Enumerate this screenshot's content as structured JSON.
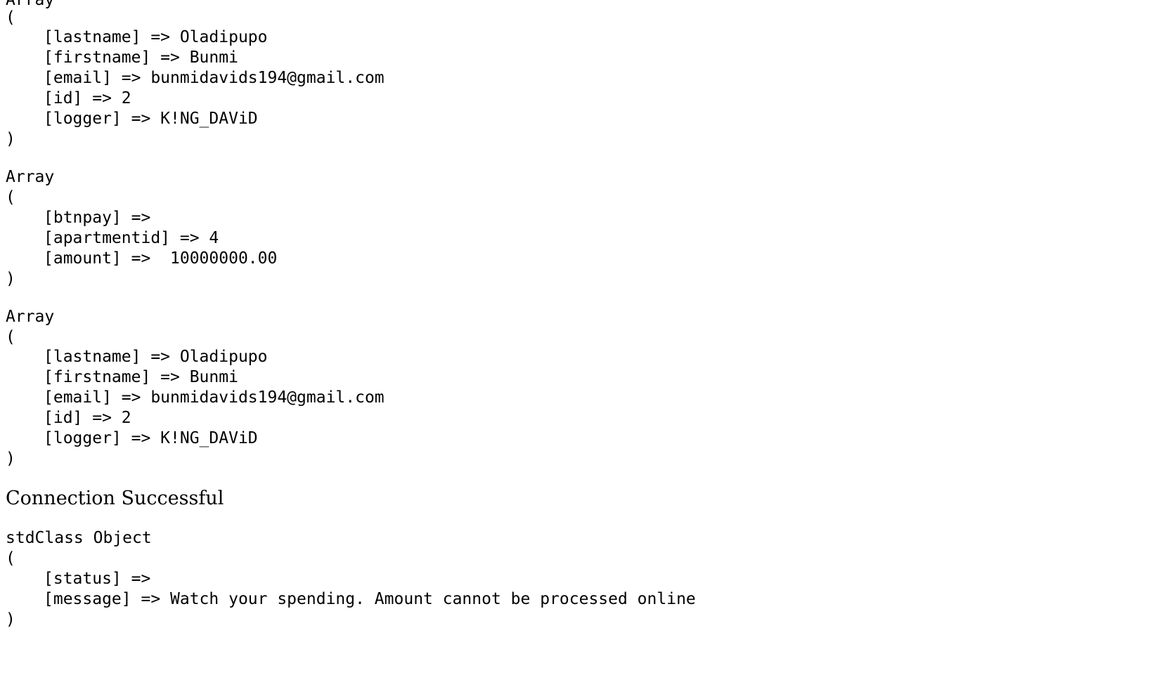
{
  "block1": {
    "header": "Array",
    "open": "(",
    "lines": [
      "[lastname] => Oladipupo",
      "[firstname] => Bunmi",
      "[email] => bunmidavids194@gmail.com",
      "[id] => 2",
      "[logger] => K!NG_DAViD"
    ],
    "close": ")"
  },
  "block2": {
    "header": "Array",
    "open": "(",
    "lines": [
      "[btnpay] =>",
      "[apartmentid] => 4",
      "[amount] =>  10000000.00"
    ],
    "close": ")"
  },
  "block3": {
    "header": "Array",
    "open": "(",
    "lines": [
      "[lastname] => Oladipupo",
      "[firstname] => Bunmi",
      "[email] => bunmidavids194@gmail.com",
      "[id] => 2",
      "[logger] => K!NG_DAViD"
    ],
    "close": ")"
  },
  "connection_message": "Connection Successful",
  "block4": {
    "header": "stdClass Object",
    "open": "(",
    "lines": [
      "[status] =>",
      "[message] => Watch your spending. Amount cannot be processed online"
    ],
    "close": ")"
  }
}
